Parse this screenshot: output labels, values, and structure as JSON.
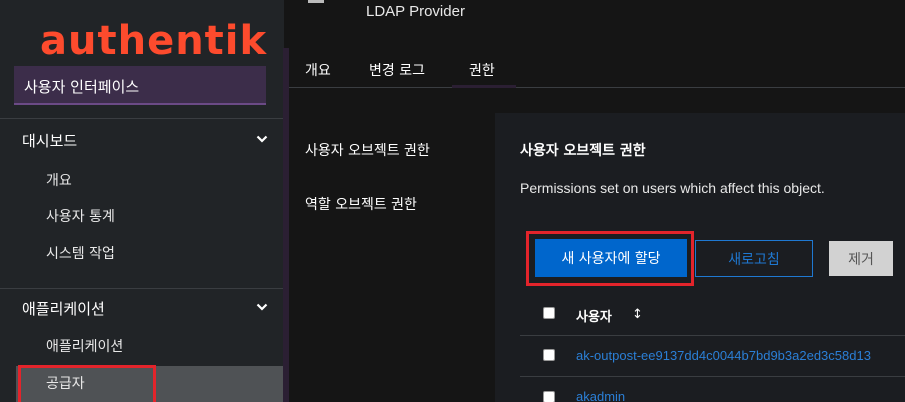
{
  "brand": {
    "logo_text": "authentik"
  },
  "header": {
    "subtitle": "LDAP Provider"
  },
  "sidebar": {
    "top_item": "사용자 인터페이스",
    "groups": [
      {
        "title": "대시보드",
        "items": [
          "개요",
          "사용자 통계",
          "시스템 작업"
        ]
      },
      {
        "title": "애플리케이션",
        "items": [
          "애플리케이션",
          "공급자"
        ]
      }
    ]
  },
  "tabs": [
    "개요",
    "변경 로그",
    "권한"
  ],
  "active_tab": "권한",
  "secondary_nav": [
    "사용자 오브젝트 권한",
    "역할 오브젝트 권한"
  ],
  "card": {
    "title": "사용자 오브젝트 권한",
    "description": "Permissions set on users which affect this object.",
    "buttons": {
      "assign": "새 사용자에 할당",
      "refresh": "새로고침",
      "remove": "제거"
    },
    "table": {
      "column_user": "사용자",
      "rows": [
        "ak-outpost-ee9137dd4c0044b7bd9b3a2ed3c58d13",
        "akadmin"
      ]
    }
  },
  "colors": {
    "accent_primary": "#0066cc",
    "highlight": "#e3242b",
    "brand": "#fd4b2d",
    "link": "#2b7fd6"
  }
}
